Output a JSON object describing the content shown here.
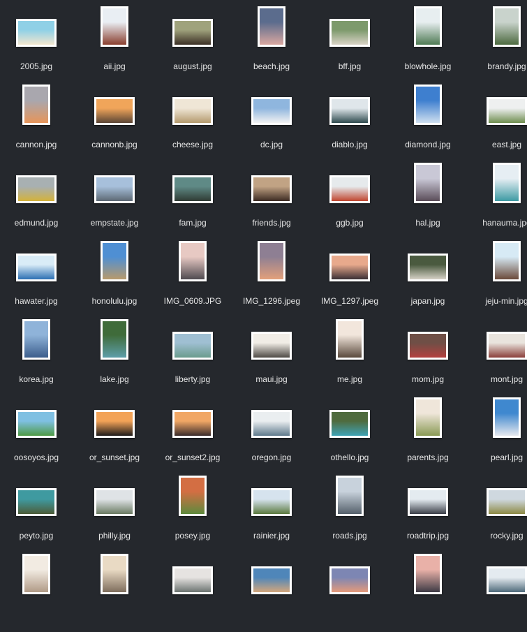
{
  "files": [
    {
      "name": "2005.jpg",
      "orientation": "landscape",
      "colors": [
        "#8fd0e6",
        "#f2e6cf"
      ]
    },
    {
      "name": "aii.jpg",
      "orientation": "portrait",
      "colors": [
        "#e9eef3",
        "#8a3f2f"
      ]
    },
    {
      "name": "august.jpg",
      "orientation": "landscape",
      "colors": [
        "#9fa27c",
        "#3b2f25"
      ]
    },
    {
      "name": "beach.jpg",
      "orientation": "portrait",
      "colors": [
        "#5b6c8d",
        "#d9a7a0"
      ]
    },
    {
      "name": "bff.jpg",
      "orientation": "landscape",
      "colors": [
        "#7d9a6c",
        "#d9d3c6"
      ]
    },
    {
      "name": "blowhole.jpg",
      "orientation": "portrait",
      "colors": [
        "#e7eef0",
        "#4f7a54"
      ]
    },
    {
      "name": "brandy.jpg",
      "orientation": "portrait",
      "colors": [
        "#c9d3cc",
        "#4d6a40"
      ]
    },
    {
      "name": "cannon.jpg",
      "orientation": "portrait",
      "colors": [
        "#a9a7ae",
        "#e6955a"
      ]
    },
    {
      "name": "cannonb.jpg",
      "orientation": "landscape",
      "colors": [
        "#f0a55a",
        "#5a4535"
      ]
    },
    {
      "name": "cheese.jpg",
      "orientation": "landscape",
      "colors": [
        "#efe6d6",
        "#b49a6e"
      ]
    },
    {
      "name": "dc.jpg",
      "orientation": "landscape",
      "colors": [
        "#8fb6de",
        "#f2f2f2"
      ]
    },
    {
      "name": "diablo.jpg",
      "orientation": "landscape",
      "colors": [
        "#dfe6ea",
        "#2f4a4e"
      ]
    },
    {
      "name": "diamond.jpg",
      "orientation": "portrait",
      "colors": [
        "#3e7fcf",
        "#cfe0ef"
      ]
    },
    {
      "name": "east.jpg",
      "orientation": "landscape",
      "colors": [
        "#eef0f0",
        "#6f8e4f"
      ]
    },
    {
      "name": "edmund.jpg",
      "orientation": "landscape",
      "colors": [
        "#a8b0b2",
        "#d4b23a"
      ]
    },
    {
      "name": "empstate.jpg",
      "orientation": "landscape",
      "colors": [
        "#a7c0db",
        "#5c6873"
      ]
    },
    {
      "name": "fam.jpg",
      "orientation": "landscape",
      "colors": [
        "#5f8a86",
        "#2f3a33"
      ]
    },
    {
      "name": "friends.jpg",
      "orientation": "landscape",
      "colors": [
        "#c1a384",
        "#3b2a22"
      ]
    },
    {
      "name": "ggb.jpg",
      "orientation": "landscape",
      "colors": [
        "#e6eaec",
        "#c0452f"
      ]
    },
    {
      "name": "hal.jpg",
      "orientation": "portrait",
      "colors": [
        "#c9c8d6",
        "#5a4c58"
      ]
    },
    {
      "name": "hanauma.jpg",
      "orientation": "portrait",
      "colors": [
        "#e6eef3",
        "#3d9aa3"
      ]
    },
    {
      "name": "hawater.jpg",
      "orientation": "landscape",
      "colors": [
        "#d9ecf7",
        "#2c6fb3"
      ]
    },
    {
      "name": "honolulu.jpg",
      "orientation": "portrait",
      "colors": [
        "#4f8fd3",
        "#b89a6c"
      ]
    },
    {
      "name": "IMG_0609.JPG",
      "orientation": "portrait",
      "colors": [
        "#e7c9c3",
        "#4f4a50"
      ]
    },
    {
      "name": "IMG_1296.jpeg",
      "orientation": "portrait",
      "colors": [
        "#8e7f93",
        "#e3a07b"
      ]
    },
    {
      "name": "IMG_1297.jpeg",
      "orientation": "landscape",
      "colors": [
        "#e8a98c",
        "#3a2f35"
      ]
    },
    {
      "name": "japan.jpg",
      "orientation": "landscape",
      "colors": [
        "#4a5a3f",
        "#d6d1c6"
      ]
    },
    {
      "name": "jeju-min.jpg",
      "orientation": "portrait",
      "colors": [
        "#d7eaf5",
        "#6b4a3a"
      ]
    },
    {
      "name": "korea.jpg",
      "orientation": "portrait",
      "colors": [
        "#8fb3d9",
        "#3c5e8c"
      ]
    },
    {
      "name": "lake.jpg",
      "orientation": "portrait",
      "colors": [
        "#3f6b3a",
        "#5d9ea9"
      ]
    },
    {
      "name": "liberty.jpg",
      "orientation": "landscape",
      "colors": [
        "#9fbfd2",
        "#6a9c8d"
      ]
    },
    {
      "name": "maui.jpg",
      "orientation": "landscape",
      "colors": [
        "#f1ede6",
        "#4e4a45"
      ]
    },
    {
      "name": "me.jpg",
      "orientation": "portrait",
      "colors": [
        "#f2e6dc",
        "#5a4a3d"
      ]
    },
    {
      "name": "mom.jpg",
      "orientation": "landscape",
      "colors": [
        "#6f4f46",
        "#b3403f"
      ]
    },
    {
      "name": "mont.jpg",
      "orientation": "landscape",
      "colors": [
        "#e9e4dd",
        "#8b3f3a"
      ]
    },
    {
      "name": "oosoyos.jpg",
      "orientation": "landscape",
      "colors": [
        "#7fc0e2",
        "#4e9a45"
      ]
    },
    {
      "name": "or_sunset.jpg",
      "orientation": "landscape",
      "colors": [
        "#f3a357",
        "#1f1b1a"
      ]
    },
    {
      "name": "or_sunset2.jpg",
      "orientation": "landscape",
      "colors": [
        "#f1a765",
        "#3a2b2a"
      ]
    },
    {
      "name": "oregon.jpg",
      "orientation": "landscape",
      "colors": [
        "#eaeef0",
        "#5f7a8c"
      ]
    },
    {
      "name": "othello.jpg",
      "orientation": "landscape",
      "colors": [
        "#4f6b3e",
        "#3fa3b5"
      ]
    },
    {
      "name": "parents.jpg",
      "orientation": "portrait",
      "colors": [
        "#efe6da",
        "#8a9a55"
      ]
    },
    {
      "name": "pearl.jpg",
      "orientation": "portrait",
      "colors": [
        "#3f88cf",
        "#e6e9ee"
      ]
    },
    {
      "name": "peyto.jpg",
      "orientation": "landscape",
      "colors": [
        "#3f9aa0",
        "#4c5b38"
      ]
    },
    {
      "name": "philly.jpg",
      "orientation": "landscape",
      "colors": [
        "#dfe3e6",
        "#6b7b63"
      ]
    },
    {
      "name": "posey.jpg",
      "orientation": "portrait",
      "colors": [
        "#d36e43",
        "#5e8a3d"
      ]
    },
    {
      "name": "rainier.jpg",
      "orientation": "landscape",
      "colors": [
        "#d6e3ee",
        "#5b7a3f"
      ]
    },
    {
      "name": "roads.jpg",
      "orientation": "portrait",
      "colors": [
        "#c8d2dc",
        "#55606b"
      ]
    },
    {
      "name": "roadtrip.jpg",
      "orientation": "landscape",
      "colors": [
        "#e4ebf0",
        "#3b3f48"
      ]
    },
    {
      "name": "rocky.jpg",
      "orientation": "landscape",
      "colors": [
        "#cfd8df",
        "#8d8a45"
      ]
    },
    {
      "name": "",
      "orientation": "portrait",
      "colors": [
        "#f2ebe2",
        "#b09a86"
      ]
    },
    {
      "name": "",
      "orientation": "portrait",
      "colors": [
        "#e9dac4",
        "#7e6d5c"
      ]
    },
    {
      "name": "",
      "orientation": "landscape",
      "colors": [
        "#e6e3e1",
        "#6b7370"
      ]
    },
    {
      "name": "",
      "orientation": "landscape",
      "colors": [
        "#4f86b9",
        "#d4a77c"
      ]
    },
    {
      "name": "",
      "orientation": "landscape",
      "colors": [
        "#7d86b3",
        "#e59a7a"
      ]
    },
    {
      "name": "",
      "orientation": "portrait",
      "colors": [
        "#e9b1a8",
        "#3d3a44"
      ]
    },
    {
      "name": "",
      "orientation": "landscape",
      "colors": [
        "#e4ebf0",
        "#4e6a7a"
      ]
    }
  ]
}
